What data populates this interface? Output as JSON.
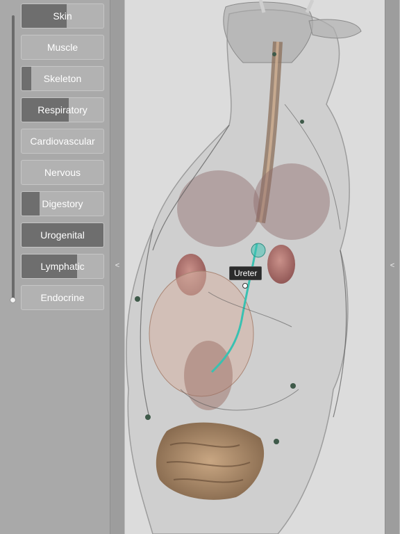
{
  "systems_panel": {
    "items": [
      {
        "label": "Skin",
        "level": 0.55
      },
      {
        "label": "Muscle",
        "level": 0.0
      },
      {
        "label": "Skeleton",
        "level": 0.12
      },
      {
        "label": "Respiratory",
        "level": 0.58
      },
      {
        "label": "Cardiovascular",
        "level": 0.0
      },
      {
        "label": "Nervous",
        "level": 0.0
      },
      {
        "label": "Digestory",
        "level": 0.22
      },
      {
        "label": "Urogenital",
        "level": 1.0
      },
      {
        "label": "Lymphatic",
        "level": 0.68
      },
      {
        "label": "Endocrine",
        "level": 0.0
      }
    ],
    "fill_color": "#6e6e6e"
  },
  "left_handle": {
    "glyph": "<"
  },
  "right_handle": {
    "glyph": "<"
  },
  "viewport": {
    "selected_label": "Ureter",
    "highlight_color": "#39c1b1"
  }
}
